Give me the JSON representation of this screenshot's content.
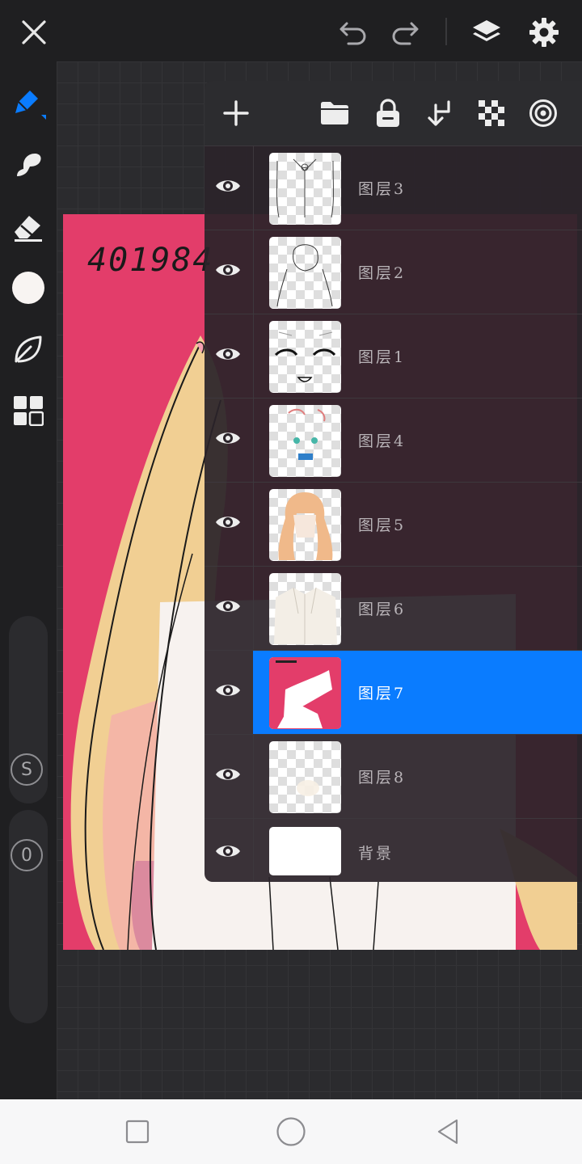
{
  "colors": {
    "accent": "#0a7cff",
    "canvas_bg": "#e33d6a",
    "current_color": "#f8f4f2",
    "ui_dark": "#1f1f21"
  },
  "topbar": {
    "icons": [
      "close-icon",
      "undo-icon",
      "redo-icon",
      "layers-icon",
      "settings-icon"
    ]
  },
  "tools": {
    "items": [
      "pen-icon",
      "smudge-icon",
      "eraser-icon",
      "color-swatch",
      "leaf-icon",
      "grid-icon"
    ],
    "size_slider_label": "S",
    "opacity_slider_label": "0"
  },
  "canvas": {
    "artwork_text": "401984"
  },
  "layers_panel": {
    "toolbar_icons": [
      "add-layer-icon",
      "folder-icon",
      "lock-icon",
      "merge-down-icon",
      "transparency-icon",
      "blend-icon"
    ],
    "layers": [
      {
        "name": "图层3",
        "visible": true,
        "selected": false
      },
      {
        "name": "图层2",
        "visible": true,
        "selected": false
      },
      {
        "name": "图层1",
        "visible": true,
        "selected": false
      },
      {
        "name": "图层4",
        "visible": true,
        "selected": false
      },
      {
        "name": "图层5",
        "visible": true,
        "selected": false
      },
      {
        "name": "图层6",
        "visible": true,
        "selected": false
      },
      {
        "name": "图层7",
        "visible": true,
        "selected": true
      },
      {
        "name": "图层8",
        "visible": true,
        "selected": false
      },
      {
        "name": "背景",
        "visible": true,
        "selected": false
      }
    ]
  },
  "navbar": {
    "icons": [
      "recents-icon",
      "home-icon",
      "back-icon"
    ]
  }
}
